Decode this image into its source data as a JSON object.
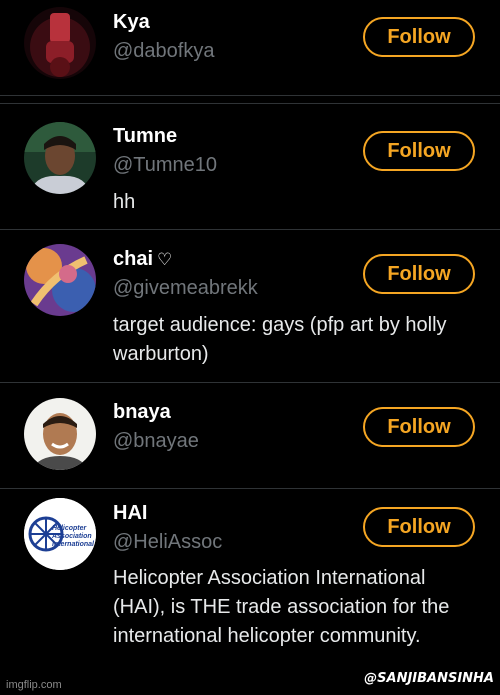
{
  "accounts": [
    {
      "name": "Kya",
      "handle": "@dabofkya",
      "bio": "",
      "follow_label": "Follow"
    },
    {
      "name": "Tumne",
      "handle": "@Tumne10",
      "bio": "hh",
      "follow_label": "Follow"
    },
    {
      "name": "chai",
      "name_suffix": "♡",
      "handle": "@givemeabrekk",
      "bio": "target audience: gays (pfp art by holly warburton)",
      "follow_label": "Follow"
    },
    {
      "name": "bnaya",
      "handle": "@bnayae",
      "bio": "",
      "follow_label": "Follow"
    },
    {
      "name": "HAI",
      "handle": "@HeliAssoc",
      "bio": "Helicopter Association International (HAI), is THE trade association for the international helicopter community.",
      "follow_label": "Follow",
      "avatar_text": "Helicopter Association International"
    }
  ],
  "watermarks": {
    "imgflip": "imgflip.com",
    "credit": "@SANJIBANSINHA"
  },
  "colors": {
    "accent": "#f5a623",
    "background": "#000000",
    "secondary_text": "#71767b",
    "divider": "#2f3336"
  }
}
